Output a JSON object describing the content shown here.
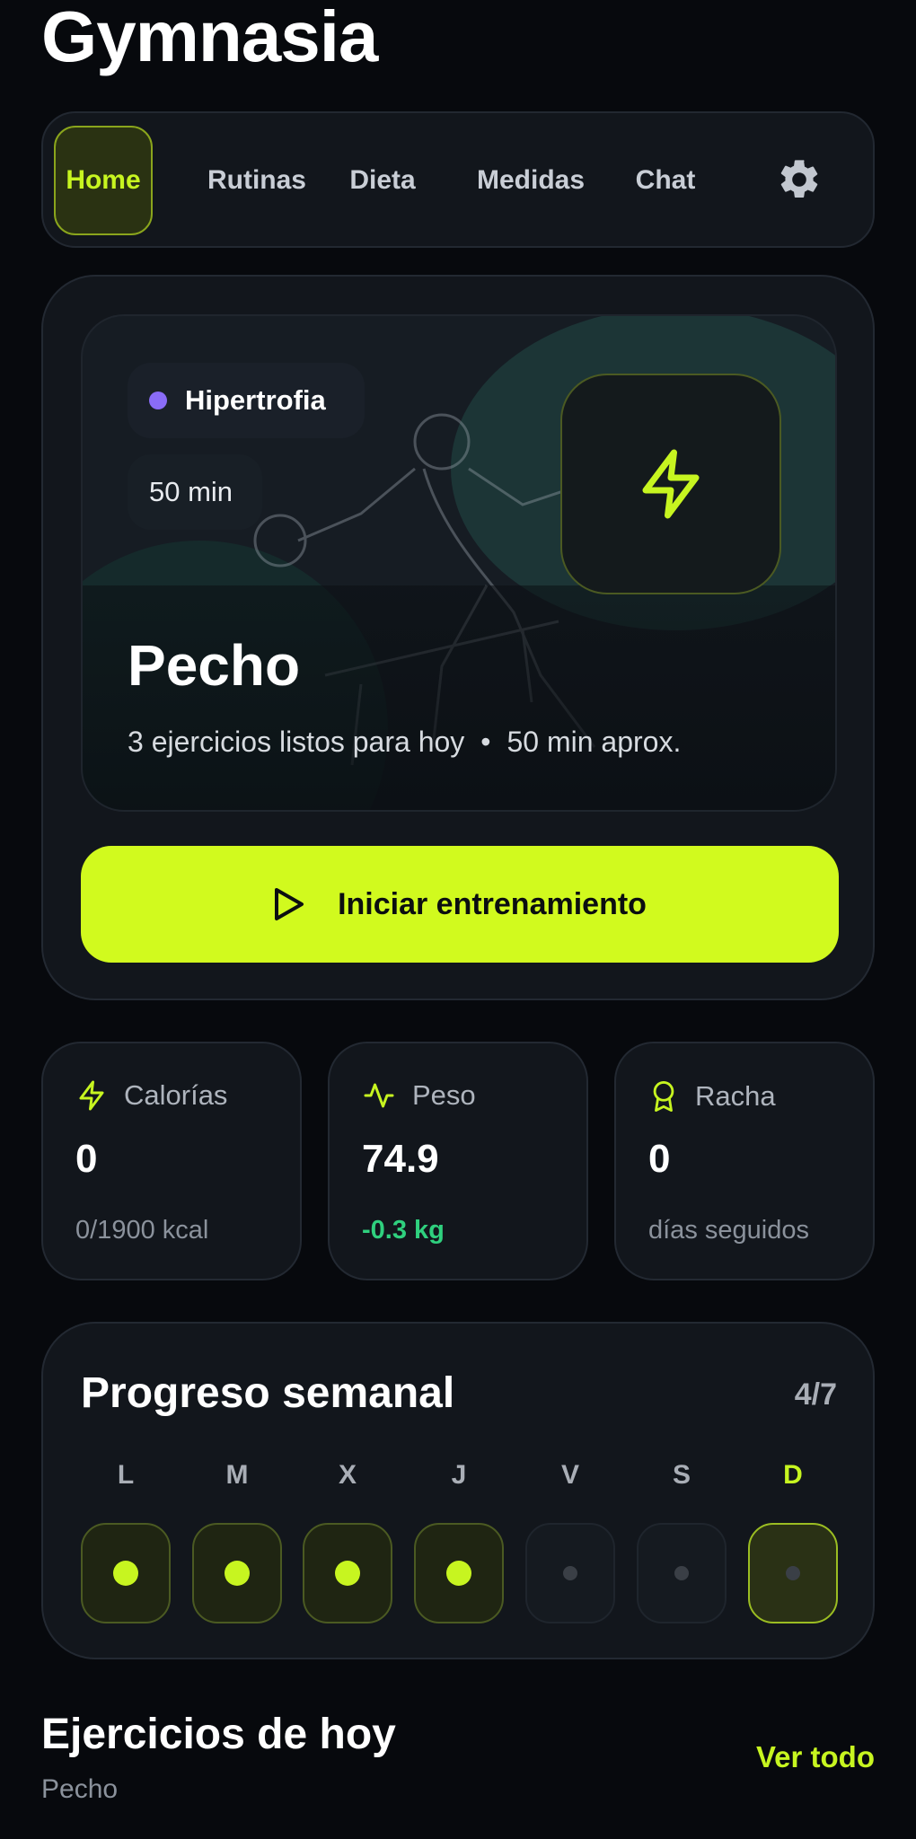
{
  "app": {
    "title": "Gymnasia"
  },
  "nav": {
    "items": [
      {
        "label": "Home",
        "active": true
      },
      {
        "label": "Rutinas"
      },
      {
        "label": "Dieta"
      },
      {
        "label": "Medidas"
      },
      {
        "label": "Chat"
      }
    ],
    "settings_icon": "gear-icon"
  },
  "hero": {
    "type_badge": "Hipertrofia",
    "type_color": "#8a6cf7",
    "duration_badge": "50 min",
    "title": "Pecho",
    "subtitle_exercises": "3 ejercicios listos para hoy",
    "subtitle_sep": "•",
    "subtitle_duration": "50 min aprox.",
    "icon": "bolt-icon",
    "start_label": "Iniciar entrenamiento",
    "start_icon": "play-icon"
  },
  "stats": [
    {
      "icon": "bolt-icon",
      "label": "Calorías",
      "value": "0",
      "sub": "0/1900 kcal"
    },
    {
      "icon": "activity-icon",
      "label": "Peso",
      "value": "74.9",
      "sub": "-0.3 kg"
    },
    {
      "icon": "award-icon",
      "label": "Racha",
      "value": "0",
      "sub": "días seguidos"
    }
  ],
  "weekly": {
    "title": "Progreso semanal",
    "count": "4/7",
    "days": [
      {
        "letter": "L",
        "done": true
      },
      {
        "letter": "M",
        "done": true
      },
      {
        "letter": "X",
        "done": true
      },
      {
        "letter": "J",
        "done": true
      },
      {
        "letter": "V",
        "done": false
      },
      {
        "letter": "S",
        "done": false
      },
      {
        "letter": "D",
        "done": false,
        "today": true
      }
    ]
  },
  "exercises": {
    "title": "Ejercicios de hoy",
    "subtitle": "Pecho",
    "link": "Ver todo"
  },
  "colors": {
    "accent": "#c7f520",
    "button": "#d1fa1e",
    "positive": "#2fd07e",
    "background": "#07090d",
    "card": "#12161c"
  }
}
